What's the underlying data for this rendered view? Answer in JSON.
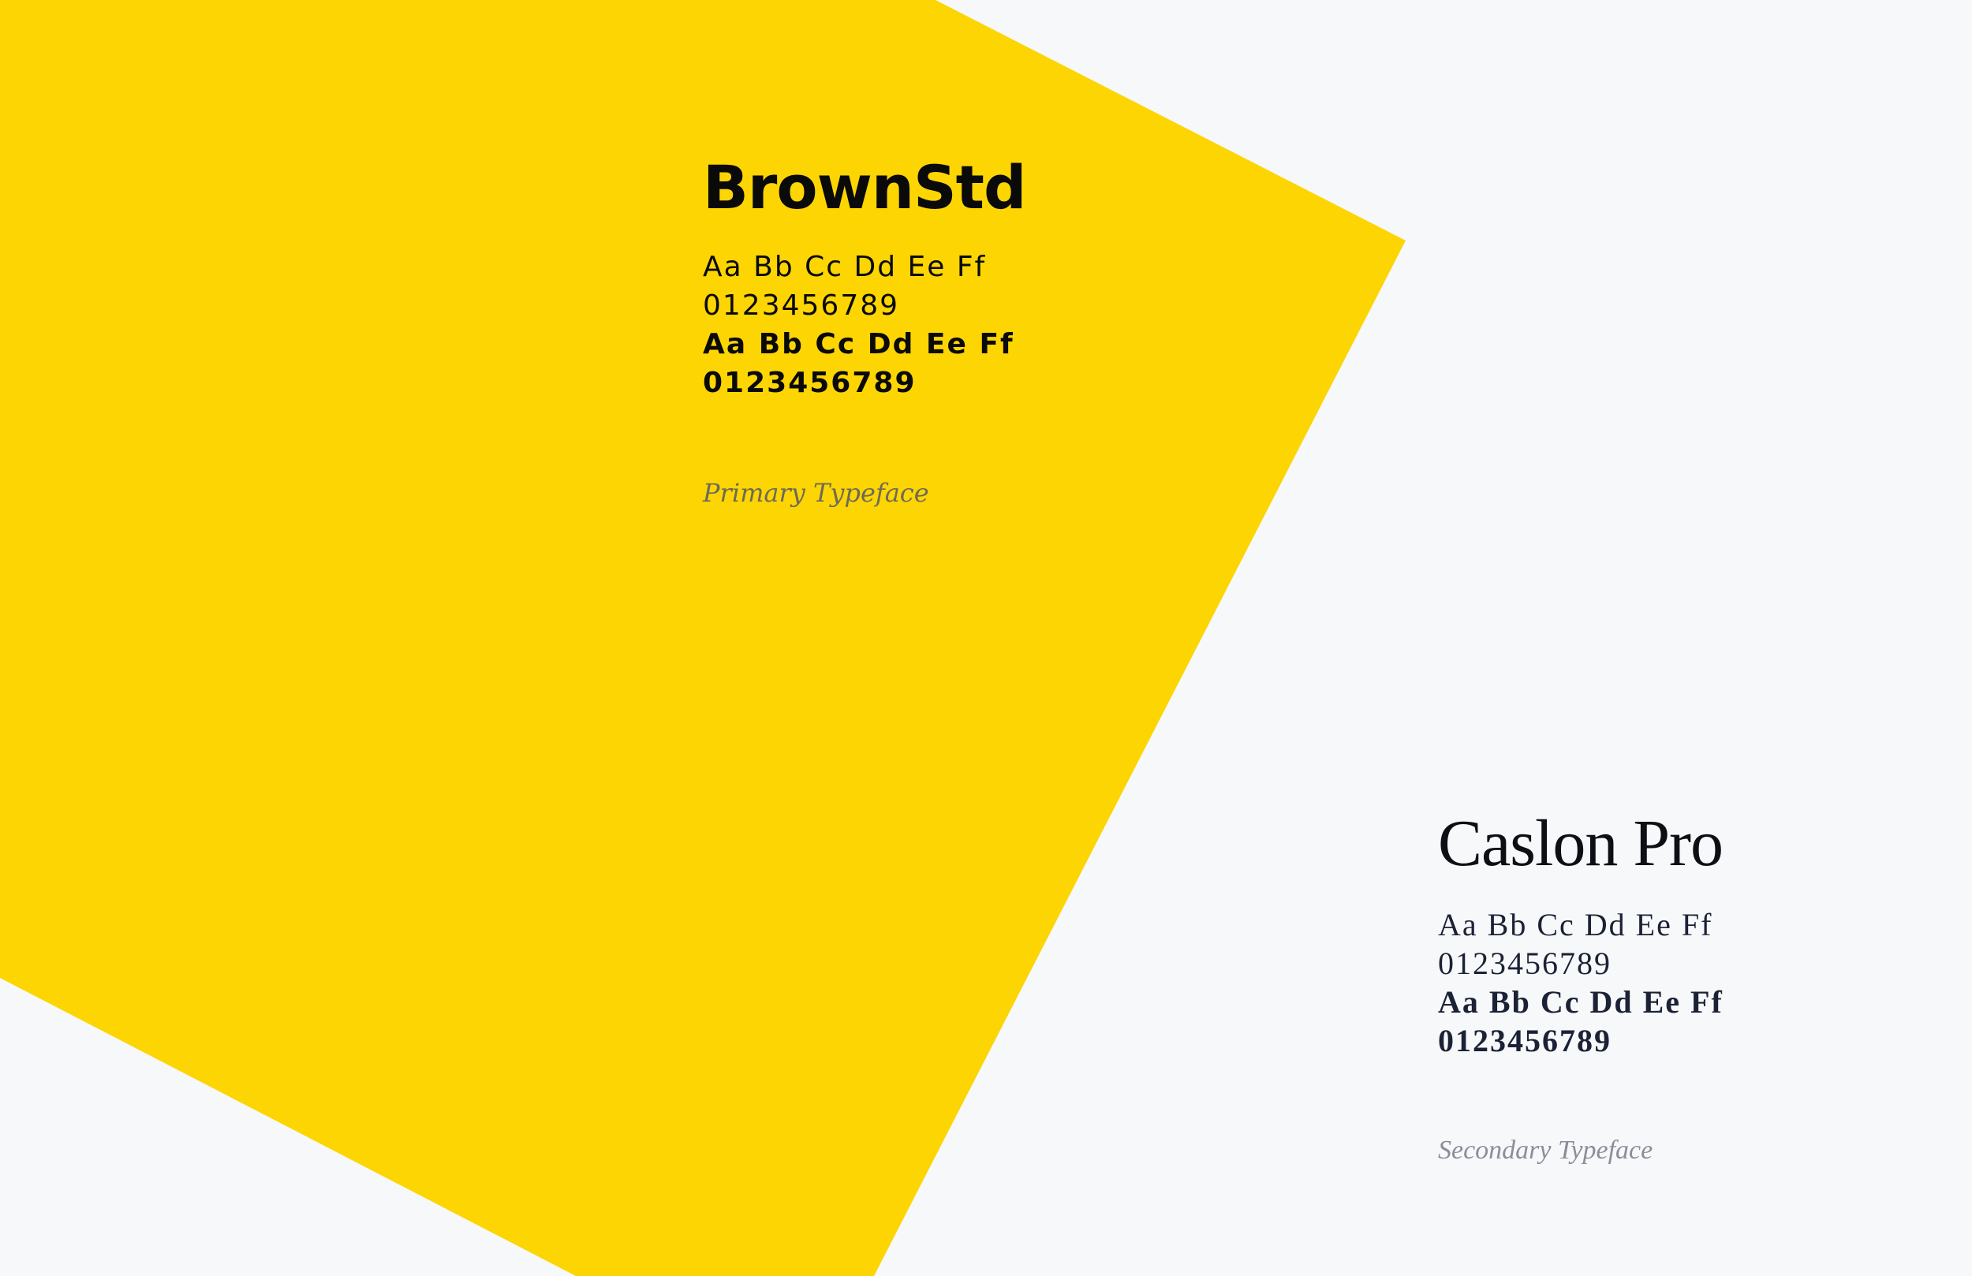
{
  "colors": {
    "background": "#f7f8f9",
    "accent_yellow": "#fcd503",
    "primary_text": "#0a0a0a",
    "secondary_text": "#1b2236"
  },
  "primary_typeface": {
    "name": "BrownStd",
    "regular_letters": "Aa Bb Cc Dd Ee Ff",
    "regular_numbers": "0123456789",
    "bold_letters": "Aa Bb Cc Dd Ee Ff",
    "bold_numbers": "0123456789",
    "caption": "Primary Typeface"
  },
  "secondary_typeface": {
    "name": "Caslon Pro",
    "regular_letters": "Aa Bb Cc Dd Ee Ff",
    "regular_numbers": "0123456789",
    "bold_letters": "Aa Bb Cc Dd Ee Ff",
    "bold_numbers": "0123456789",
    "caption": "Secondary Typeface"
  }
}
